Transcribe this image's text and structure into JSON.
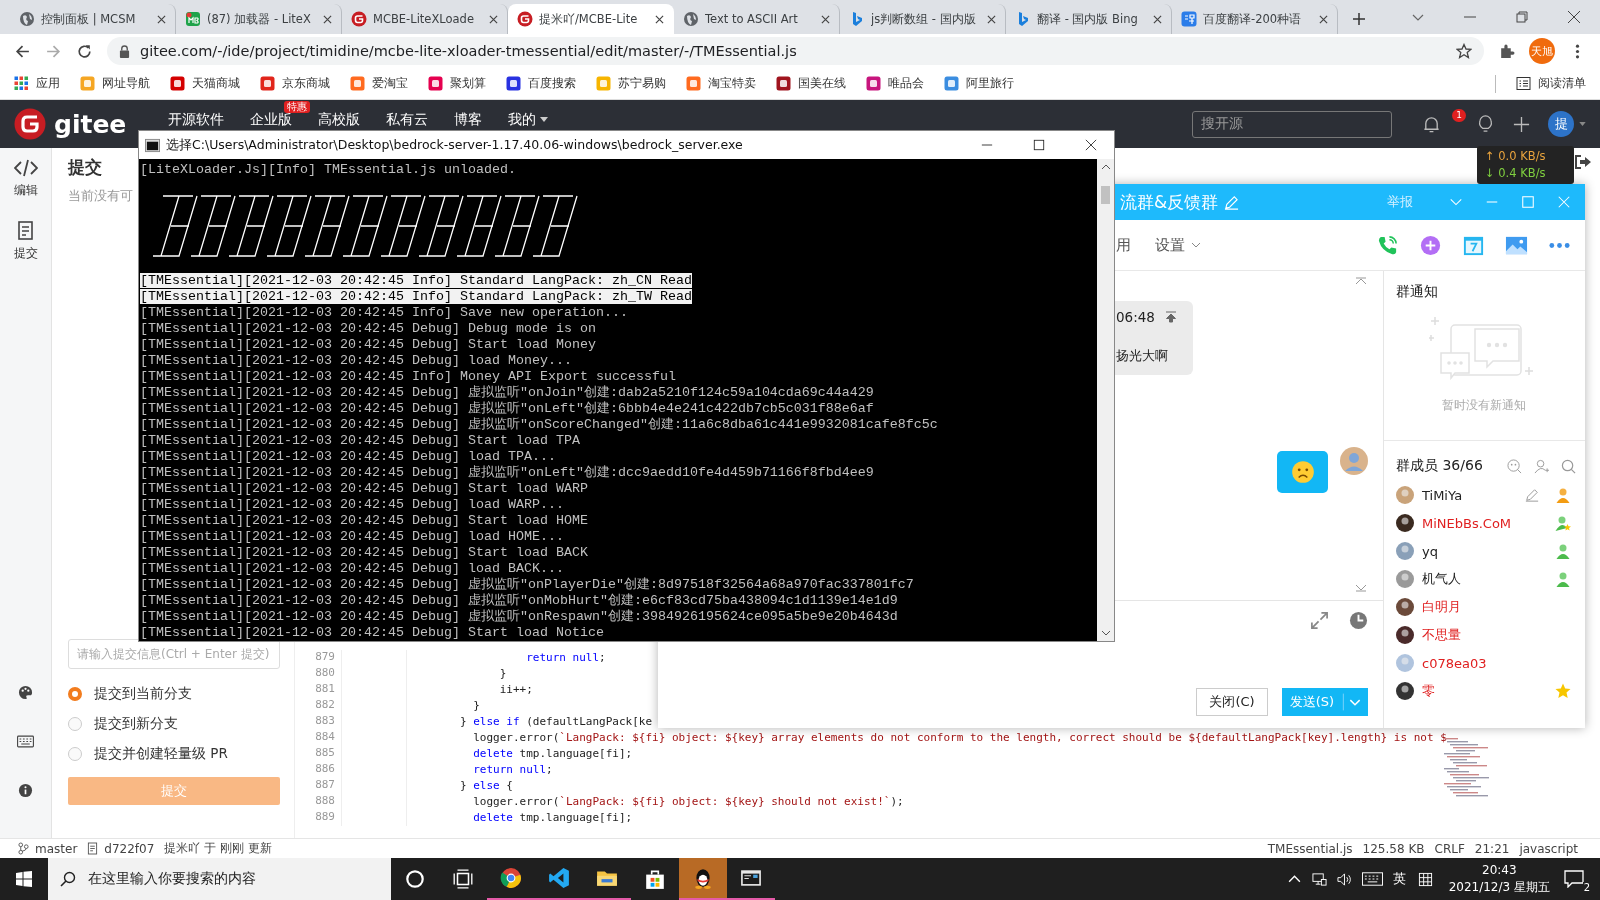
{
  "browser": {
    "tabs": [
      {
        "title": "控制面板 | MCSM",
        "kind": "globe",
        "selected": false
      },
      {
        "title": "(87) 加载器 - LiteX",
        "kind": "mb",
        "selected": false
      },
      {
        "title": "MCBE-LiteXLoade",
        "kind": "gitee",
        "selected": false
      },
      {
        "title": "提米吖/MCBE-Lite",
        "kind": "gitee",
        "selected": true
      },
      {
        "title": "Text to ASCII Art",
        "kind": "globe",
        "selected": false
      },
      {
        "title": "js判断数组 - 国内版",
        "kind": "bing",
        "selected": false
      },
      {
        "title": "翻译 - 国内版 Bing",
        "kind": "bing",
        "selected": false
      },
      {
        "title": "百度翻译-200种语",
        "kind": "translate",
        "selected": false
      }
    ],
    "url": "gitee.com/-/ide/project/timidine/mcbe-lite-xloader-tmessential/edit/master/-/TMEssential.js",
    "profile": "天旭",
    "bookmarks": [
      {
        "label": "应用",
        "kind": "apps",
        "color": "#1a73e8"
      },
      {
        "label": "网址导航",
        "kind": "site",
        "color": "#f5a623"
      },
      {
        "label": "天猫商城",
        "kind": "site",
        "color": "#d40000"
      },
      {
        "label": "京东商城",
        "kind": "site",
        "color": "#e1251b"
      },
      {
        "label": "爱淘宝",
        "kind": "site",
        "color": "#ff6a1f"
      },
      {
        "label": "聚划算",
        "kind": "site",
        "color": "#e5004f"
      },
      {
        "label": "百度搜索",
        "kind": "site",
        "color": "#2932e1"
      },
      {
        "label": "苏宁易购",
        "kind": "site",
        "color": "#f7b500"
      },
      {
        "label": "淘宝特卖",
        "kind": "site",
        "color": "#ff6a1f"
      },
      {
        "label": "国美在线",
        "kind": "site",
        "color": "#a0141e"
      },
      {
        "label": "唯品会",
        "kind": "site",
        "color": "#c7157d"
      },
      {
        "label": "阿里旅行",
        "kind": "site",
        "color": "#3b8de0"
      }
    ],
    "reading_list": "阅读清单"
  },
  "gitee": {
    "logo": "gitee",
    "nav": [
      {
        "label": "开源软件",
        "dropdown": false
      },
      {
        "label": "企业版",
        "badge": "特惠",
        "dropdown": false
      },
      {
        "label": "高校版",
        "dropdown": false
      },
      {
        "label": "私有云",
        "dropdown": false
      },
      {
        "label": "博客",
        "dropdown": false
      },
      {
        "label": "我的",
        "dropdown": true
      }
    ],
    "search_placeholder": "搜开源",
    "notifications": "1",
    "avatar": "提",
    "sidebar": [
      {
        "label": "编辑",
        "kind": "code"
      },
      {
        "label": "提交",
        "kind": "commit"
      }
    ],
    "commit_panel": {
      "title": "提交",
      "note": "当前没有可",
      "placeholder": "请输入提交信息(Ctrl + Enter 提交)",
      "options": [
        {
          "label": "提交到当前分支",
          "selected": true
        },
        {
          "label": "提交到新分支",
          "selected": false
        },
        {
          "label": "提交并创建轻量级 PR",
          "selected": false
        }
      ],
      "button": "提交"
    },
    "editor": {
      "lines": [
        {
          "number": "879",
          "tokens": [
            {
              "kind": "keyword",
              "text": "                  return null"
            },
            {
              "kind": "plain",
              "text": ";"
            }
          ]
        },
        {
          "number": "880",
          "tokens": [
            {
              "kind": "plain",
              "text": "              }"
            }
          ]
        },
        {
          "number": "881",
          "tokens": [
            {
              "kind": "plain",
              "text": "              ii++;"
            }
          ]
        },
        {
          "number": "882",
          "tokens": [
            {
              "kind": "plain",
              "text": "          }"
            }
          ]
        },
        {
          "number": "883",
          "tokens": [
            {
              "kind": "plain",
              "text": "        } "
            },
            {
              "kind": "keyword",
              "text": "else if"
            },
            {
              "kind": "plain",
              "text": " (defaultLangPack[ke"
            }
          ]
        },
        {
          "number": "884",
          "tokens": [
            {
              "kind": "plain",
              "text": "          logger.error("
            },
            {
              "kind": "string",
              "text": "`LangPack: ${fi} object: ${key} array elements do not conform to the length, correct should be ${defaultLangPack[key].length} is not $"
            }
          ]
        },
        {
          "number": "885",
          "tokens": [
            {
              "kind": "keyword",
              "text": "          delete"
            },
            {
              "kind": "plain",
              "text": " tmp.language[fi];"
            }
          ]
        },
        {
          "number": "886",
          "tokens": [
            {
              "kind": "keyword",
              "text": "          return null"
            },
            {
              "kind": "plain",
              "text": ";"
            }
          ]
        },
        {
          "number": "887",
          "tokens": [
            {
              "kind": "plain",
              "text": "        } "
            },
            {
              "kind": "keyword",
              "text": "else"
            },
            {
              "kind": "plain",
              "text": " {"
            }
          ]
        },
        {
          "number": "888",
          "tokens": [
            {
              "kind": "plain",
              "text": "          logger.error("
            },
            {
              "kind": "string",
              "text": "`LangPack: ${fi} object: ${key} should not exist!`"
            },
            {
              "kind": "plain",
              "text": ");"
            }
          ]
        },
        {
          "number": "889",
          "tokens": [
            {
              "kind": "keyword",
              "text": "          delete"
            },
            {
              "kind": "plain",
              "text": " tmp.language[fi];"
            }
          ]
        }
      ]
    },
    "status_bar": {
      "branch": "master",
      "commit": "d722f07",
      "update": "提米吖 于 刚刚 更新",
      "file": "TMEssential.js",
      "size": "125.58 KB",
      "eol": "CRLF",
      "position": "21:21",
      "language": "javascript"
    }
  },
  "console": {
    "title": "选择C:\\Users\\Administrator\\Desktop\\bedrock-server-1.17.40.06-windows\\bedrock_server.exe",
    "first_line": "[LiteXLoader.Js][Info] TMEssential.js unloaded.",
    "lines": [
      {
        "text": "[TMEssential][2021-12-03 20:42:45 Info] Standard LangPack: zh_CN Read",
        "selected": true
      },
      {
        "text": "[TMEssential][2021-12-03 20:42:45 Info] Standard LangPack: zh_TW Read",
        "selected": true
      },
      {
        "text": "[TMEssential][2021-12-03 20:42:45 Info] Save new operation...",
        "selected": false
      },
      {
        "text": "[TMEssential][2021-12-03 20:42:45 Debug] Debug mode is on",
        "selected": false
      },
      {
        "text": "[TMEssential][2021-12-03 20:42:45 Debug] Start load Money",
        "selected": false
      },
      {
        "text": "[TMEssential][2021-12-03 20:42:45 Debug] load Money...",
        "selected": false
      },
      {
        "text": "[TMEssential][2021-12-03 20:42:45 Info] Money API Export successful",
        "selected": false
      },
      {
        "text": "[TMEssential][2021-12-03 20:42:45 Debug] 虚拟监听″onJoin″创建:dab2a5210f124c59a104cda69c44a429",
        "selected": false
      },
      {
        "text": "[TMEssential][2021-12-03 20:42:45 Debug] 虚拟监听″onLeft″创建:6bbb4e4e241c422db7cb5c031f88e6af",
        "selected": false
      },
      {
        "text": "[TMEssential][2021-12-03 20:42:45 Debug] 虚拟监听″onScoreChanged″创建:11a6c8dba61c441e9932081cafe8fc5c",
        "selected": false
      },
      {
        "text": "[TMEssential][2021-12-03 20:42:45 Debug] Start load TPA",
        "selected": false
      },
      {
        "text": "[TMEssential][2021-12-03 20:42:45 Debug] load TPA...",
        "selected": false
      },
      {
        "text": "[TMEssential][2021-12-03 20:42:45 Debug] 虚拟监听″onLeft″创建:dcc9aedd10fe4d459b71166f8fbd4ee9",
        "selected": false
      },
      {
        "text": "[TMEssential][2021-12-03 20:42:45 Debug] Start load WARP",
        "selected": false
      },
      {
        "text": "[TMEssential][2021-12-03 20:42:45 Debug] load WARP...",
        "selected": false
      },
      {
        "text": "[TMEssential][2021-12-03 20:42:45 Debug] Start load HOME",
        "selected": false
      },
      {
        "text": "[TMEssential][2021-12-03 20:42:45 Debug] load HOME...",
        "selected": false
      },
      {
        "text": "[TMEssential][2021-12-03 20:42:45 Debug] Start load BACK",
        "selected": false
      },
      {
        "text": "[TMEssential][2021-12-03 20:42:45 Debug] load BACK...",
        "selected": false
      },
      {
        "text": "[TMEssential][2021-12-03 20:42:45 Debug] 虚拟监听″onPlayerDie″创建:8d97518f32564a68a970fac337801fc7",
        "selected": false
      },
      {
        "text": "[TMEssential][2021-12-03 20:42:45 Debug] 虚拟监听″onMobHurt″创建:e6cf83cd75ba438094c1d1139e14e1d9",
        "selected": false
      },
      {
        "text": "[TMEssential][2021-12-03 20:42:45 Debug] 虚拟监听″onRespawn″创建:3984926195624ce095a5be9e20b4643d",
        "selected": false
      },
      {
        "text": "[TMEssential][2021-12-03 20:42:45 Debug] Start load Notice",
        "selected": false
      }
    ]
  },
  "qq": {
    "title": "流群&反馈群",
    "report": "举报",
    "toolbar_partial": "用",
    "settings": "设置",
    "message": {
      "time": "06:48",
      "text": "扬光大啊"
    },
    "close_button": "关闭(C)",
    "send_button": "发送(S)",
    "notice": {
      "title": "群通知",
      "empty": "暂时没有新通知"
    },
    "members_title": "群成员 36/66",
    "members": [
      {
        "name": "TiMiYa",
        "color": "#222222",
        "kind": "owner",
        "editable": true
      },
      {
        "name": "MiNEbBs.CoM",
        "color": "#e02020",
        "kind": "admin",
        "editable": false
      },
      {
        "name": "yq",
        "color": "#222222",
        "kind": "member",
        "editable": false
      },
      {
        "name": "机气人",
        "color": "#222222",
        "kind": "member",
        "editable": false
      },
      {
        "name": "白明月",
        "color": "#e02020",
        "kind": "plain",
        "editable": false
      },
      {
        "name": "不思量",
        "color": "#e02020",
        "kind": "plain",
        "editable": false
      },
      {
        "name": "c078ea03",
        "color": "#e02020",
        "kind": "plain",
        "editable": false
      },
      {
        "name": "零",
        "color": "#e02020",
        "kind": "star",
        "editable": false
      }
    ]
  },
  "net_speed": {
    "up": "↑ 0.0 KB/s",
    "down": "↓ 0.4 KB/s"
  },
  "taskbar": {
    "search_placeholder": "在这里输入你要搜索的内容",
    "apps": [
      {
        "kind": "chrome",
        "running": true,
        "selected": false
      },
      {
        "kind": "vscode",
        "running": true,
        "selected": false
      },
      {
        "kind": "files",
        "running": true,
        "selected": false
      },
      {
        "kind": "store",
        "running": false,
        "selected": false
      },
      {
        "kind": "qq",
        "running": true,
        "selected": true
      },
      {
        "kind": "console",
        "running": true,
        "selected": false
      }
    ],
    "ime": "英",
    "time": "20:43",
    "date": "2021/12/3 星期五",
    "notifications": "2"
  }
}
